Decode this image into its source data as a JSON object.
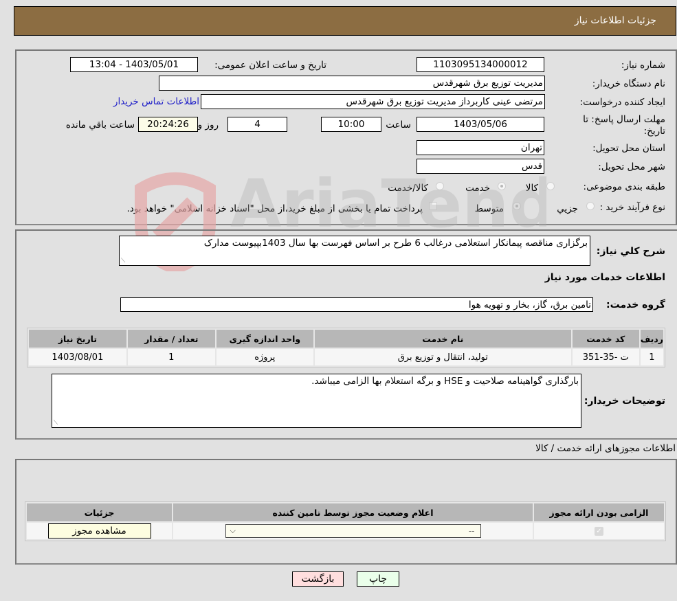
{
  "header": {
    "title": "جزئیات اطلاعات نیاز"
  },
  "form": {
    "need_number": {
      "label": "شماره نیاز:",
      "value": "1103095134000012"
    },
    "announce_datetime": {
      "label": "تاریخ و ساعت اعلان عمومی:",
      "value": "1403/05/01 - 13:04"
    },
    "buyer_org": {
      "label": "نام دستگاه خریدار:",
      "value": "مدیریت توزیع برق شهرقدس"
    },
    "requester": {
      "label": "ایجاد کننده درخواست:",
      "value": "مرتضی عینی کاربرداز مدیریت توزیع برق شهرقدس"
    },
    "buyer_contact_link": "اطلاعات تماس خریدار",
    "deadline": {
      "label_line1": "مهلت ارسال پاسخ: تا",
      "label_line2": "تاریخ:",
      "date": "1403/05/06",
      "time_label": "ساعت",
      "time": "10:00",
      "days": "4",
      "days_label": "روز و",
      "remaining": "20:24:26",
      "remaining_label": "ساعت باقي مانده"
    },
    "province": {
      "label": "استان محل تحویل:",
      "value": "تهران"
    },
    "city": {
      "label": "شهر محل تحویل:",
      "value": "قدس"
    },
    "category": {
      "label": "طبقه بندی موضوعی:",
      "options": [
        "کالا",
        "خدمت",
        "کالا/خدمت"
      ],
      "selected": "خدمت"
    },
    "purchase_type": {
      "label": "نوع فرآیند خرید :",
      "options": [
        "جزيي",
        "متوسط"
      ],
      "selected": "متوسط",
      "treasury_note": "پرداخت تمام یا بخشی از مبلغ خرید،از محل \"اسناد خزانه اسلامی\" خواهد بود.",
      "treasury_checked": false
    }
  },
  "details": {
    "general_desc_label": "شرح کلي نیاز:",
    "general_desc": "برگزاری مناقصه پیمانکار استعلامی درغالب 6 طرح بر اساس فهرست بها سال 1403بپیوست مدارک",
    "services_heading": "اطلاعات خدمات مورد نیاز",
    "service_group_label": "گروه خدمت:",
    "service_group": "تامین برق، گاز، بخار و تهویه هوا",
    "table": {
      "headers": [
        "ردیف",
        "کد خدمت",
        "نام خدمت",
        "واحد اندازه گیری",
        "تعداد / مقدار",
        "تاریخ نیاز"
      ],
      "rows": [
        [
          "1",
          "ت -35-351",
          "تولید، انتقال و توزیع برق",
          "پروژه",
          "1",
          "1403/08/01"
        ]
      ]
    },
    "buyer_notes_label": "توضیحات خریدار:",
    "buyer_notes": "بارگذاری گواهینامه صلاحیت و HSE و برگه استعلام بها الزامی میباشد."
  },
  "permits": {
    "heading": "اطلاعات مجوزهای ارائه خدمت / کالا",
    "headers": [
      "الزامی بودن ارائه مجوز",
      "اعلام وضعیت مجوز توسط تامین کننده",
      "جزئیات"
    ],
    "rows": [
      {
        "required_checked": true,
        "status_selected": "--",
        "details_button": "مشاهده مجوز"
      }
    ]
  },
  "buttons": {
    "print": "چاپ",
    "back": "بازگشت"
  },
  "watermark": {
    "text": "AriaTender.neT"
  },
  "colors": {
    "header_bg": "#8c6d42",
    "print_bg": "#eaffea",
    "back_bg": "#ffdede",
    "link": "#2020c8"
  }
}
